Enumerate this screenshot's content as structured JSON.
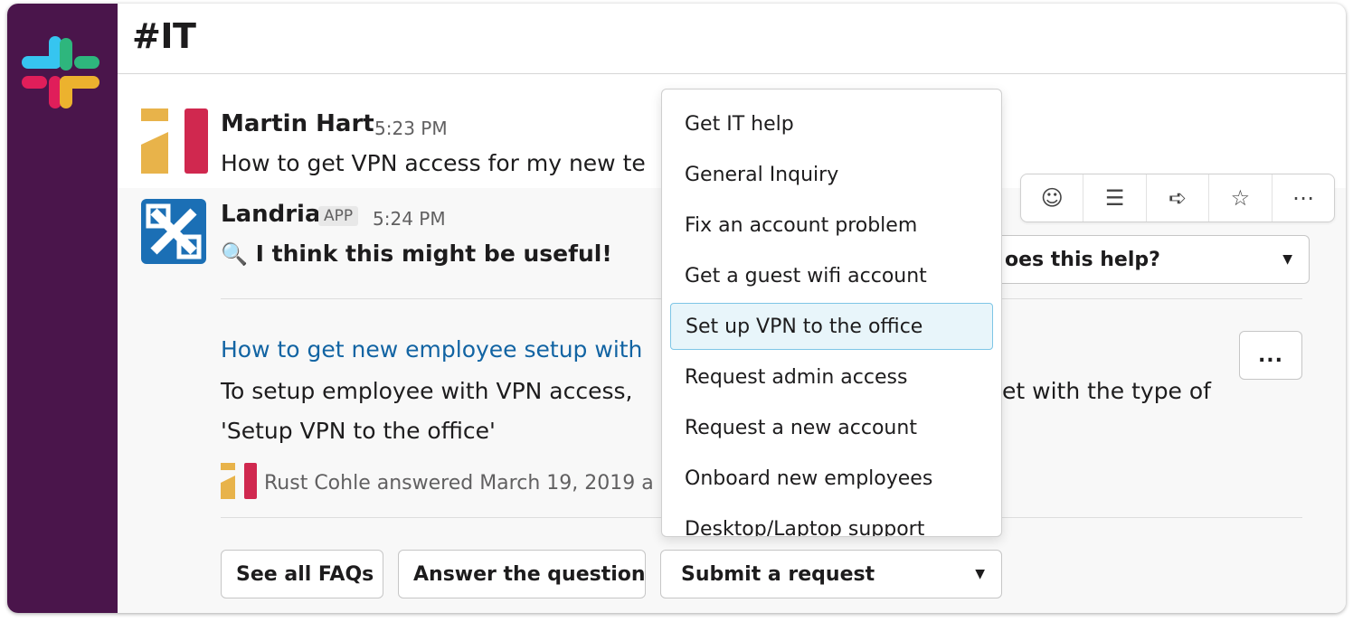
{
  "channel": {
    "title": "#IT"
  },
  "messages": [
    {
      "author": "Martin Hart",
      "time": "5:23 PM",
      "text": "How to get VPN access for my new te"
    },
    {
      "author": "Landria",
      "badge": "APP",
      "time": "5:24 PM",
      "text": "I think this might be useful!"
    }
  ],
  "faq": {
    "title": "How to get new employee setup with",
    "body_line1": "To setup employee with VPN access,",
    "body_line1_tail": "et with the type of",
    "body_line2": "'Setup VPN to the office'",
    "answered_by": "Rust Cohle answered March 19, 2019 a"
  },
  "feedback_select": {
    "label": "oes this help?"
  },
  "more_menu_label": "...",
  "actions": {
    "see_all": "See all FAQs",
    "answer": "Answer the question",
    "submit": "Submit a request"
  },
  "toolbar": {
    "icons": [
      "add-reaction-icon",
      "reply-thread-icon",
      "share-icon",
      "star-icon",
      "more-actions-icon"
    ],
    "glyphs": [
      "☺",
      "☰",
      "➪",
      "☆",
      "⋯"
    ]
  },
  "dropdown": {
    "selected_index": 4,
    "options": [
      "Get IT help",
      "General Inquiry",
      "Fix an account problem",
      "Get a guest wifi account",
      "Set up VPN to the office",
      "Request admin access",
      "Request a new account",
      "Onboard new employees",
      "Desktop/Laptop support"
    ]
  },
  "colors": {
    "sidebar": "#4a154b",
    "link": "#1264a3",
    "selected_option_bg": "#e8f5fa",
    "selected_option_border": "#7ec6e6",
    "avatar_landria": "#1b6fb5",
    "avatar_martin_gold": "#e8b34a",
    "avatar_martin_red": "#d0284f"
  }
}
